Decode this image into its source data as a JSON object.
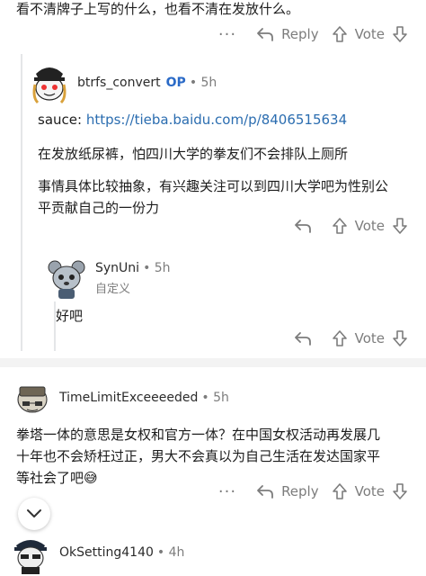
{
  "top_comment": {
    "text": "看不清牌子上写的什么，也看不清在发放什么。"
  },
  "actions": {
    "more": "···",
    "reply": "Reply",
    "vote": "Vote"
  },
  "comment_op": {
    "username": "btrfs_convert",
    "op_badge": "OP",
    "age": "• 5h",
    "sauce_label": "sauce:",
    "sauce_link": "https://tieba.baidu.com/p/8406515634",
    "para1": "在发放纸尿裤，怕四川大学的拳友们不会排队上厕所",
    "para2_line1": "事情具体比较抽象，有兴趣关注可以到四川大学吧为性别公",
    "para2_line2": "平贡献自己的一份力"
  },
  "comment_syn": {
    "username": "SynUni",
    "age": "• 5h",
    "flair": "自定义",
    "text": "好吧"
  },
  "comment_time": {
    "username": "TimeLimitExceeeeded",
    "age": "• 5h",
    "line1": "拳塔一体的意思是女权和官方一体？在中国女权活动再发展几",
    "line2": "十年也不会矫枉过正，男大不会真以为自己生活在发达国家平",
    "line3": "等社会了吧😅"
  },
  "comment_ok": {
    "username": "OkSetting4140",
    "age": "• 4h"
  },
  "icons": {
    "reply": "reply-arrow-icon",
    "upvote": "upvote-arrow-icon",
    "downvote": "downvote-arrow-icon",
    "collapse": "chevron-down-icon"
  }
}
